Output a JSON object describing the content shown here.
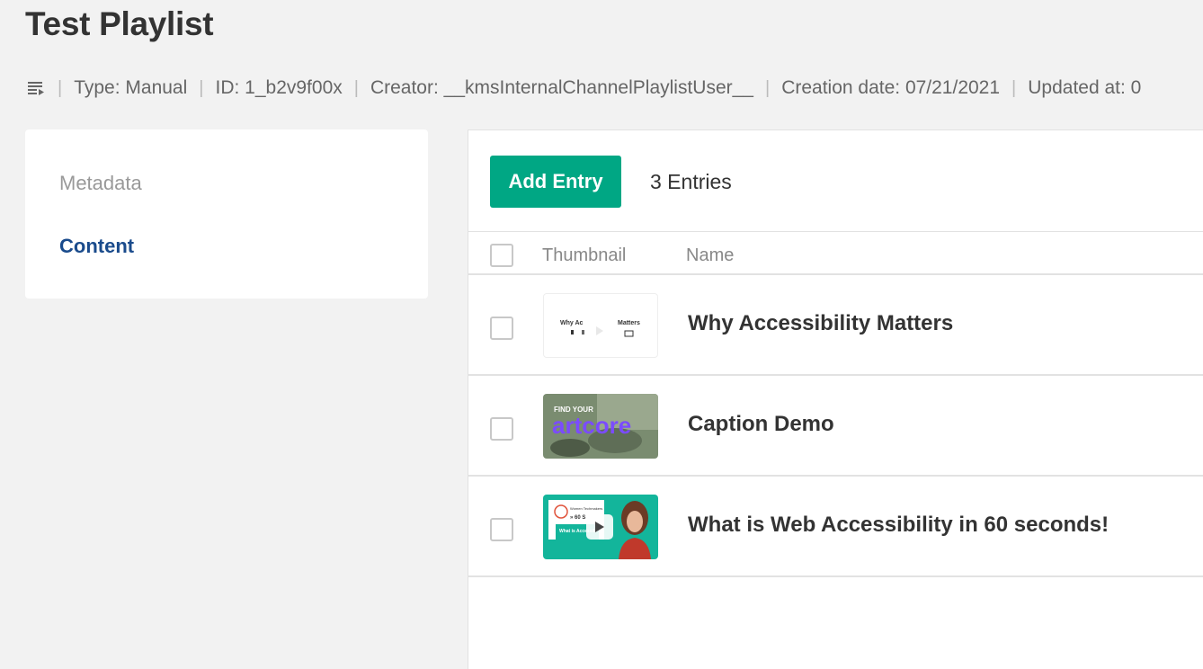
{
  "page": {
    "title": "Test Playlist"
  },
  "meta": {
    "icon": "playlist-icon",
    "type": "Type: Manual",
    "id": "ID: 1_b2v9f00x",
    "creator": "Creator: __kmsInternalChannelPlaylistUser__",
    "creation_date": "Creation date: 07/21/2021",
    "updated_at": "Updated at: 0"
  },
  "sidebar": {
    "items": [
      {
        "label": "Metadata",
        "active": false
      },
      {
        "label": "Content",
        "active": true
      }
    ]
  },
  "content": {
    "add_button_label": "Add Entry",
    "entries_count": "3 Entries",
    "columns": [
      "Thumbnail",
      "Name"
    ],
    "rows": [
      {
        "name": "Why Accessibility Matters",
        "thumb_text_left": "Why Ac",
        "thumb_text_right": "Matters"
      },
      {
        "name": "Caption Demo",
        "thumb_text_top": "FIND YOUR",
        "thumb_text_big": "artcore"
      },
      {
        "name": "What is Web Accessibility in 60 seconds!",
        "thumb_text_top": "Women Techmakers",
        "thumb_text_mid": "» 60 S",
        "thumb_text_card": "What is Accessib"
      }
    ]
  },
  "colors": {
    "accent": "#00a784",
    "link_active": "#1a4b8c",
    "background": "#f2f2f2",
    "thumb_teal": "#13b59b"
  }
}
